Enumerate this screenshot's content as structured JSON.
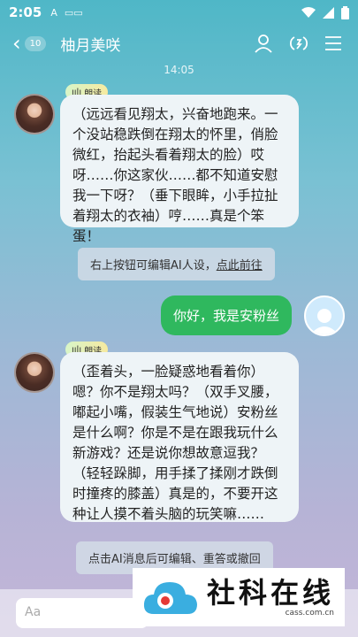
{
  "status_bar": {
    "time": "2:05",
    "icon_1": "A",
    "icon_2": "▭▭"
  },
  "header": {
    "unread_count": "10",
    "title": "柚月美咲"
  },
  "chat": {
    "timestamp": "14:05",
    "tts_label": "朗读",
    "messages": [
      {
        "sender": "ai",
        "text": "（远远看见翔太，兴奋地跑来。一个没站稳跌倒在翔太的怀里，俏脸微红，抬起头看着翔太的脸）哎呀……你这家伙……都不知道安慰我一下呀？（垂下眼眸，小手拉扯着翔太的衣袖）哼……真是个笨蛋！"
      },
      {
        "sender": "system",
        "text": "右上按钮可编辑AI人设，",
        "link": "点此前往"
      },
      {
        "sender": "user",
        "text": "你好，我是安粉丝"
      },
      {
        "sender": "ai",
        "text": "（歪着头，一脸疑惑地看着你）嗯？你不是翔太吗？（双手叉腰，嘟起小嘴，假装生气地说）安粉丝是什么啊？你是不是在跟我玩什么新游戏？还是说你想故意逗我？（轻轻跺脚，用手揉了揉刚才跌倒时撞疼的膝盖）真是的，不要开这种让人摸不着头脑的玩笑嘛……"
      },
      {
        "sender": "system",
        "text": "点击AI消息后可编辑、重答或撤回"
      }
    ]
  },
  "input": {
    "placeholder": "Aa"
  },
  "watermark": {
    "title": "社科在线",
    "url": "cass.com.cn"
  },
  "colors": {
    "accent_green": "#2fb85e",
    "bubble_ai": "#eef4f7"
  }
}
